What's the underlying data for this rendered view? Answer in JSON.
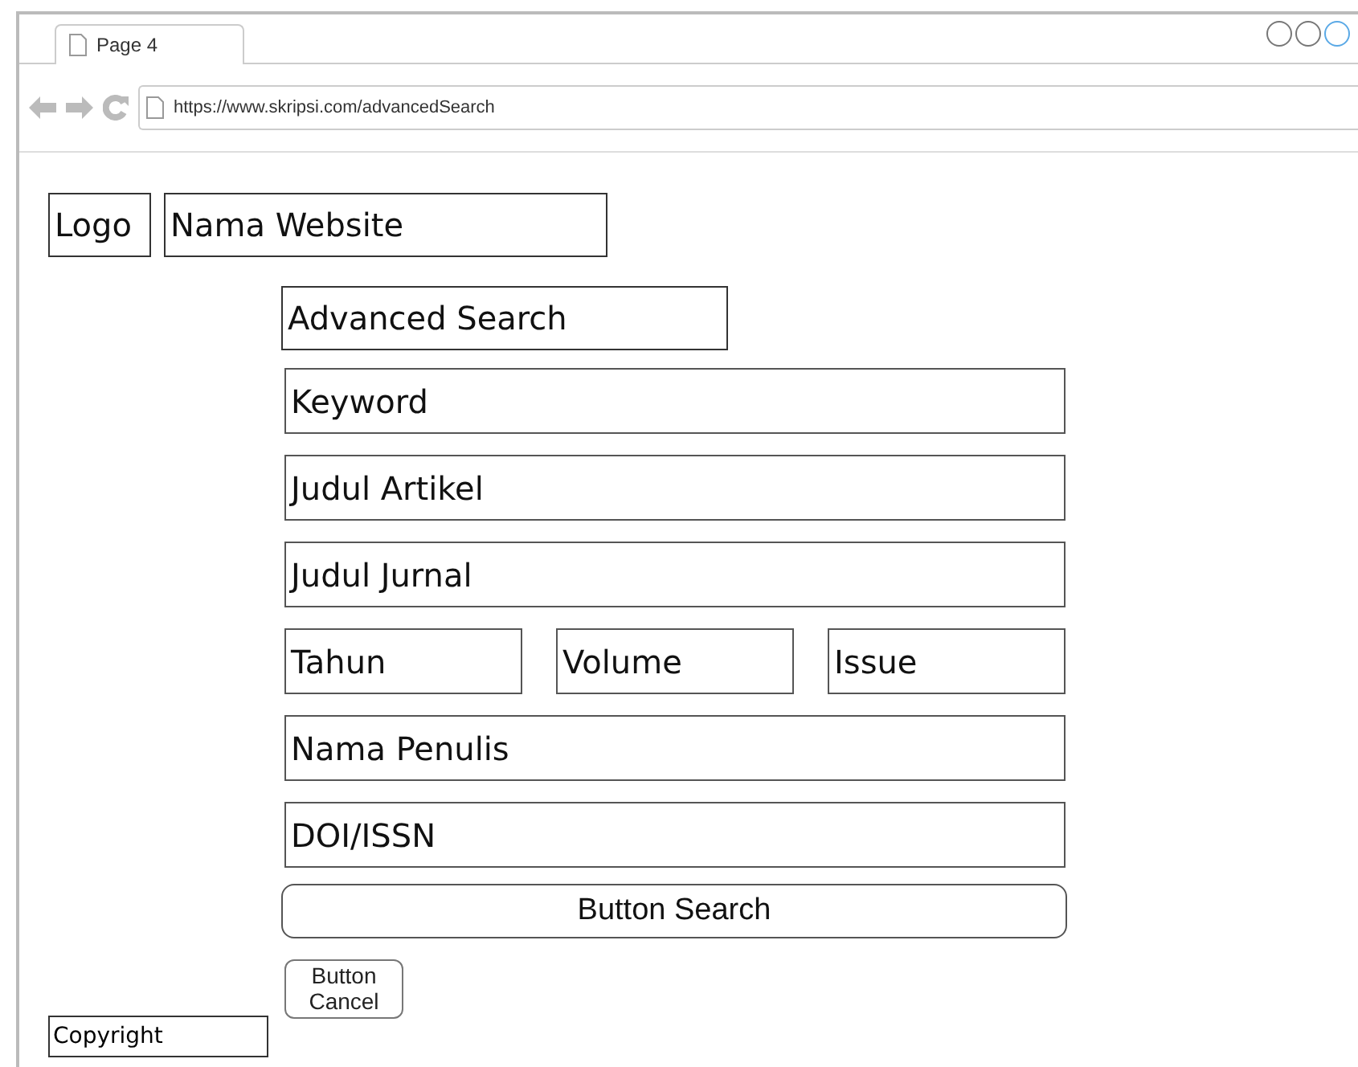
{
  "tab": {
    "title": "Page 4"
  },
  "address_bar": {
    "url": "https://www.skripsi.com/advancedSearch"
  },
  "header": {
    "logo": "Logo",
    "site_name": "Nama Website"
  },
  "form": {
    "title": "Advanced Search",
    "fields": [
      {
        "kind": "wide",
        "label": "Keyword"
      },
      {
        "kind": "wide",
        "label": "Judul Artikel"
      },
      {
        "kind": "wide",
        "label": "Judul Jurnal"
      },
      {
        "kind": "row",
        "children": [
          {
            "label": "Tahun"
          },
          {
            "label": "Volume"
          },
          {
            "label": "Issue"
          }
        ]
      },
      {
        "kind": "wide",
        "label": "Nama Penulis"
      },
      {
        "kind": "wide",
        "label": "DOI/ISSN"
      }
    ],
    "search_button": "Button Search",
    "cancel_button": "Button Cancel"
  },
  "footer": {
    "copyright": "Copyright"
  }
}
